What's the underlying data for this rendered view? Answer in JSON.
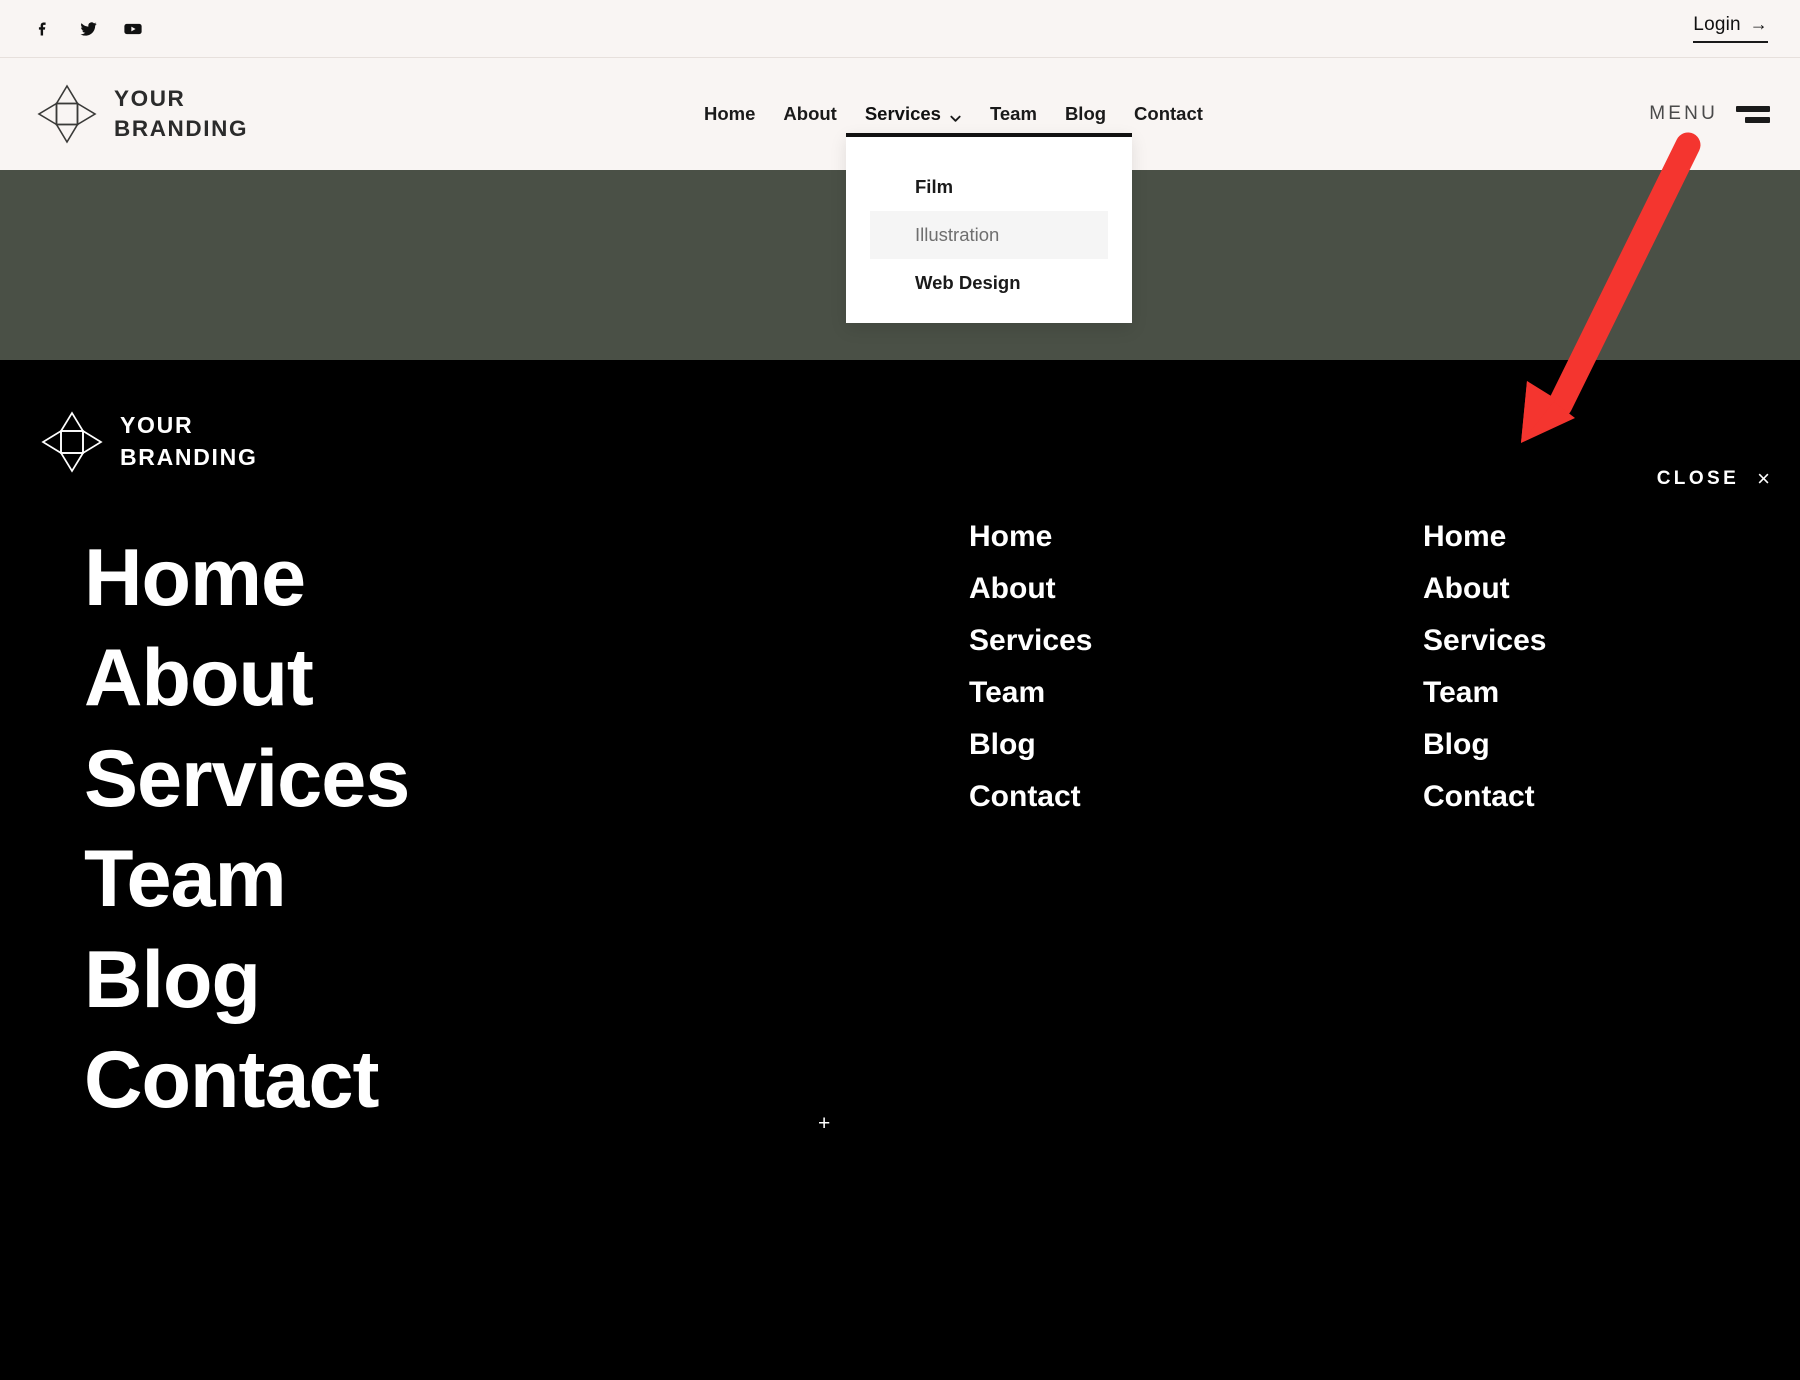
{
  "topbar": {
    "social": [
      {
        "name": "facebook-icon",
        "label": "Facebook"
      },
      {
        "name": "twitter-icon",
        "label": "Twitter"
      },
      {
        "name": "youtube-icon",
        "label": "YouTube"
      }
    ],
    "login_label": "Login",
    "login_arrow": "→"
  },
  "header": {
    "brand": {
      "line1": "YOUR",
      "line2": "BRANDING",
      "logo_icon": "four-point-star-logo"
    },
    "nav": [
      {
        "label": "Home",
        "has_caret": false
      },
      {
        "label": "About",
        "has_caret": false
      },
      {
        "label": "Services",
        "has_caret": true
      },
      {
        "label": "Team",
        "has_caret": false
      },
      {
        "label": "Blog",
        "has_caret": false
      },
      {
        "label": "Contact",
        "has_caret": false
      }
    ],
    "menu_label": "MENU",
    "menu_icon": "hamburger-icon"
  },
  "dropdown": {
    "open_for": "Services",
    "items": [
      {
        "label": "Film",
        "state": "normal"
      },
      {
        "label": "Illustration",
        "state": "hover"
      },
      {
        "label": "Web Design",
        "state": "normal"
      }
    ]
  },
  "overlay": {
    "brand": {
      "line1": "YOUR",
      "line2": "BRANDING",
      "logo_icon": "four-point-star-logo"
    },
    "close_label": "CLOSE",
    "close_symbol": "×",
    "plus_symbol": "+",
    "primary_links": [
      "Home",
      "About",
      "Services",
      "Team",
      "Blog",
      "Contact"
    ],
    "column_middle": [
      "Home",
      "About",
      "Services",
      "Team",
      "Blog",
      "Contact"
    ],
    "column_right": [
      "Home",
      "About",
      "Services",
      "Team",
      "Blog",
      "Contact"
    ]
  },
  "annotation": {
    "type": "arrow",
    "color": "#f4352f",
    "points_to": "close-button"
  },
  "colors": {
    "page_background": "#faf6f4",
    "header_background": "#f9f5f3",
    "band_green": "#4a5046",
    "overlay_black": "#000000",
    "text_dark": "#1a1a1a",
    "accent_red": "#f4352f",
    "dropdown_hover": "#f5f5f5"
  }
}
